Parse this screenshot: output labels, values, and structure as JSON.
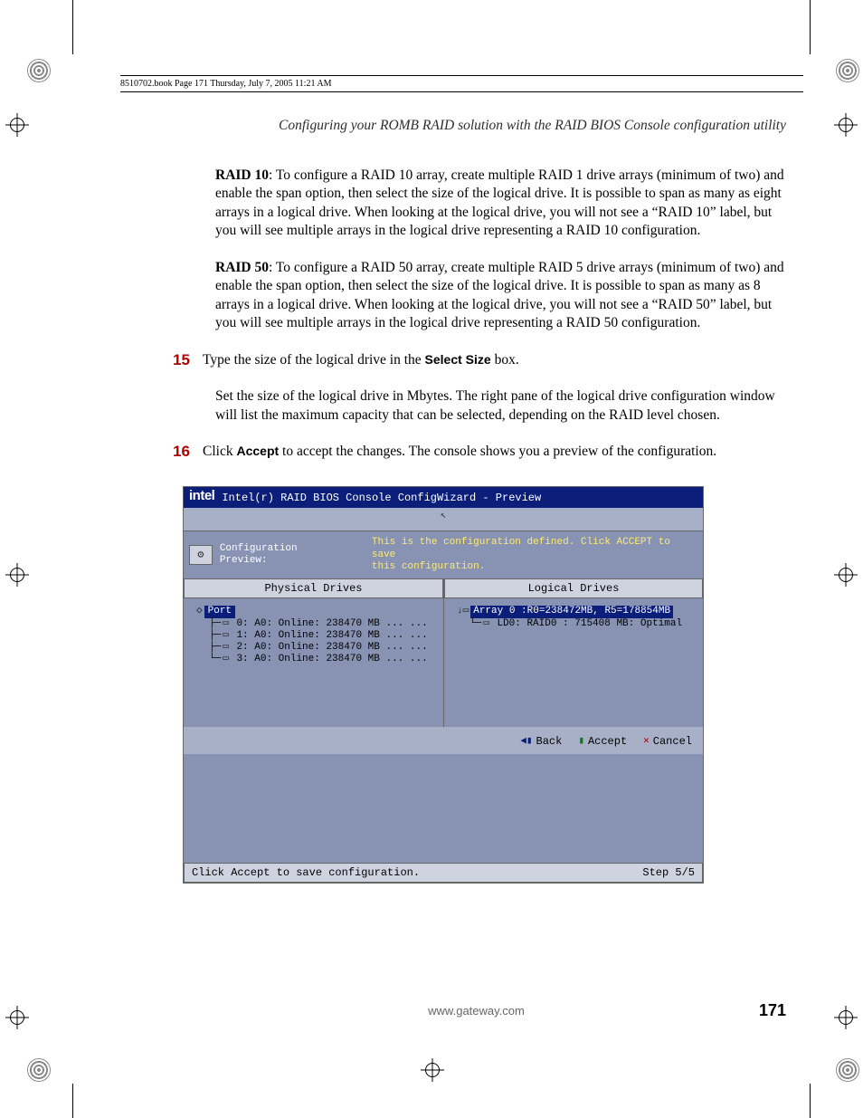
{
  "print_header": "8510702.book  Page 171  Thursday, July 7, 2005  11:21 AM",
  "section_title": "Configuring your ROMB RAID solution with the RAID BIOS Console configuration utility",
  "raid10": {
    "label": "RAID 10",
    "text": ": To configure a RAID 10 array, create multiple RAID 1 drive arrays (minimum of two) and enable the span option, then select the size of the logical drive. It is possible to span as many as eight arrays in a logical drive. When looking at the logical drive, you will not see a “RAID 10” label, but you will see multiple arrays in the logical drive representing a RAID 10 configuration."
  },
  "raid50": {
    "label": "RAID 50",
    "text": ": To configure a RAID 50 array, create multiple RAID 5 drive arrays (minimum of two) and enable the span option, then select the size of the logical drive. It is possible to span as many as 8 arrays in a logical drive. When looking at the logical drive, you will not see a “RAID 50” label, but you will see multiple arrays in the logical drive representing a RAID 50 configuration."
  },
  "step15": {
    "num": "15",
    "pre": "Type the size of the logical drive in the ",
    "bold": "Select Size",
    "post": " box.",
    "para2": "Set the size of the logical drive in Mbytes. The right pane of the logical drive configuration window will list the maximum capacity that can be selected, depending on the RAID level chosen."
  },
  "step16": {
    "num": "16",
    "pre": "Click ",
    "bold": "Accept",
    "post": " to accept the changes. The console shows you a preview of the configuration."
  },
  "screenshot": {
    "logo": "intel",
    "title": "Intel(r) RAID BIOS Console  ConfigWizard - Preview",
    "conf_label": "Configuration Preview:",
    "conf_msg_l1": "This is the configuration defined. Click ACCEPT to save",
    "conf_msg_l2": "this configuration.",
    "col1_header": "Physical Drives",
    "col2_header": "Logical Drives",
    "physical": {
      "root": "Port",
      "drives": [
        "0: A0: Online: 238470 MB ... ...",
        "1: A0: Online: 238470 MB ... ...",
        "2: A0: Online: 238470 MB ... ...",
        "3: A0: Online: 238470 MB ... ..."
      ]
    },
    "logical": {
      "array": "Array 0 :R0=238472MB, R5=178854MB",
      "ld": "LD0: RAID0 : 715408 MB: Optimal"
    },
    "buttons": {
      "back": "Back",
      "accept": "Accept",
      "cancel": "Cancel"
    },
    "status_left": "Click Accept to save configuration.",
    "status_right": "Step 5/5"
  },
  "footer": {
    "url": "www.gateway.com",
    "page": "171"
  }
}
